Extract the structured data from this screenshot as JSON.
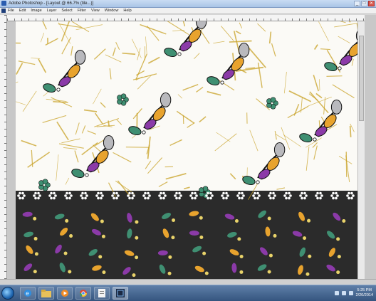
{
  "window": {
    "title": "Adobe Photoshop - [Layout @ 66.7% (tile...)]",
    "controls": [
      "_",
      "□",
      "✕"
    ]
  },
  "menu": {
    "items": [
      "File",
      "Edit",
      "Image",
      "Layer",
      "Select",
      "Filter",
      "View",
      "Window",
      "Help"
    ]
  },
  "canvas": {
    "top_background": "#fbfaf6",
    "bottom_background": "#2b2b2b",
    "gold_color": "#c9a227",
    "purple_color": "#8b3aa8",
    "green_color": "#3f8f72",
    "orange_color": "#e8a32e",
    "grey_color": "#b9b9bd"
  },
  "taskbar": {
    "start": "start-orb-icon",
    "apps": [
      "ie-icon",
      "folder-icon",
      "media-icon",
      "chrome-icon",
      "doc-icon",
      "photoshop-icon"
    ],
    "clock_time": "5:25 PM",
    "clock_date": "2/20/2014"
  }
}
